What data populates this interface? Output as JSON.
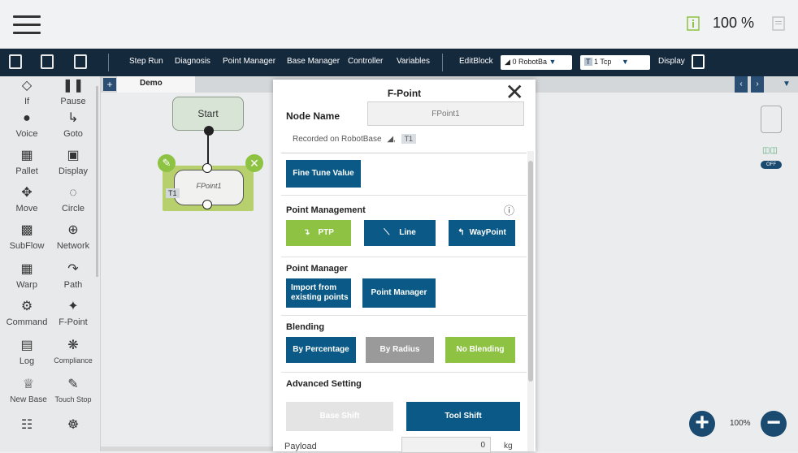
{
  "topbar": {
    "speed": "100 %",
    "icons": [
      "menu-icon",
      "info-icon",
      "page-icon"
    ]
  },
  "toolbar": {
    "items": [
      "Step Run",
      "Diagnosis",
      "Point Manager",
      "Base Manager",
      "Controller",
      "Variables"
    ],
    "editblock": "EditBlock",
    "base_dd": "0 RobotBa",
    "tcp_dd": "1 Tcp",
    "tcp_tag": "T",
    "display": "Display"
  },
  "sidebar": {
    "items": [
      {
        "label": "If",
        "icon": "if-icon"
      },
      {
        "label": "Pause",
        "icon": "pause-icon"
      },
      {
        "label": "Voice",
        "icon": "voice-icon"
      },
      {
        "label": "Goto",
        "icon": "goto-icon"
      },
      {
        "label": "Pallet",
        "icon": "pallet-icon"
      },
      {
        "label": "Display",
        "icon": "display-icon"
      },
      {
        "label": "Move",
        "icon": "move-icon"
      },
      {
        "label": "Circle",
        "icon": "circle-icon"
      },
      {
        "label": "SubFlow",
        "icon": "subflow-icon"
      },
      {
        "label": "Network",
        "icon": "network-icon"
      },
      {
        "label": "Warp",
        "icon": "warp-icon"
      },
      {
        "label": "Path",
        "icon": "path-icon"
      },
      {
        "label": "Command",
        "icon": "command-icon"
      },
      {
        "label": "F-Point",
        "icon": "fpoint-icon"
      },
      {
        "label": "Log",
        "icon": "log-icon"
      },
      {
        "label": "Compliance",
        "icon": "compliance-icon"
      },
      {
        "label": "New Base",
        "icon": "newbase-icon"
      },
      {
        "label": "Touch Stop",
        "icon": "touchstop-icon"
      }
    ]
  },
  "canvas": {
    "tab": "Demo",
    "start_label": "Start",
    "node_label": "FPoint1",
    "node_tag": "T1",
    "zoom": "100%",
    "off_label": "OFF"
  },
  "modal": {
    "title": "F-Point",
    "node_name_label": "Node Name",
    "node_name_placeholder": "FPoint1",
    "recorded_on": "Recorded on RobotBase",
    "recorded_tag": "T1",
    "fine_tune": "Fine Tune Value",
    "point_management": {
      "title": "Point Management",
      "buttons": [
        "PTP",
        "Line",
        "WayPoint"
      ],
      "active": "PTP"
    },
    "point_manager": {
      "title": "Point Manager",
      "buttons": [
        "Import from existing points",
        "Point Manager"
      ]
    },
    "blending": {
      "title": "Blending",
      "buttons": [
        "By Percentage",
        "By Radius",
        "No Blending"
      ],
      "active": "No Blending"
    },
    "advanced": {
      "title": "Advanced Setting",
      "buttons": [
        "Base Shift",
        "Tool Shift"
      ]
    },
    "payload_label": "Payload",
    "payload_value": "0",
    "payload_unit": "kg"
  },
  "colors": {
    "toolbar": "#15293d",
    "primary": "#0a5987",
    "active": "#8dc242",
    "inactive": "#9a9a9a"
  }
}
